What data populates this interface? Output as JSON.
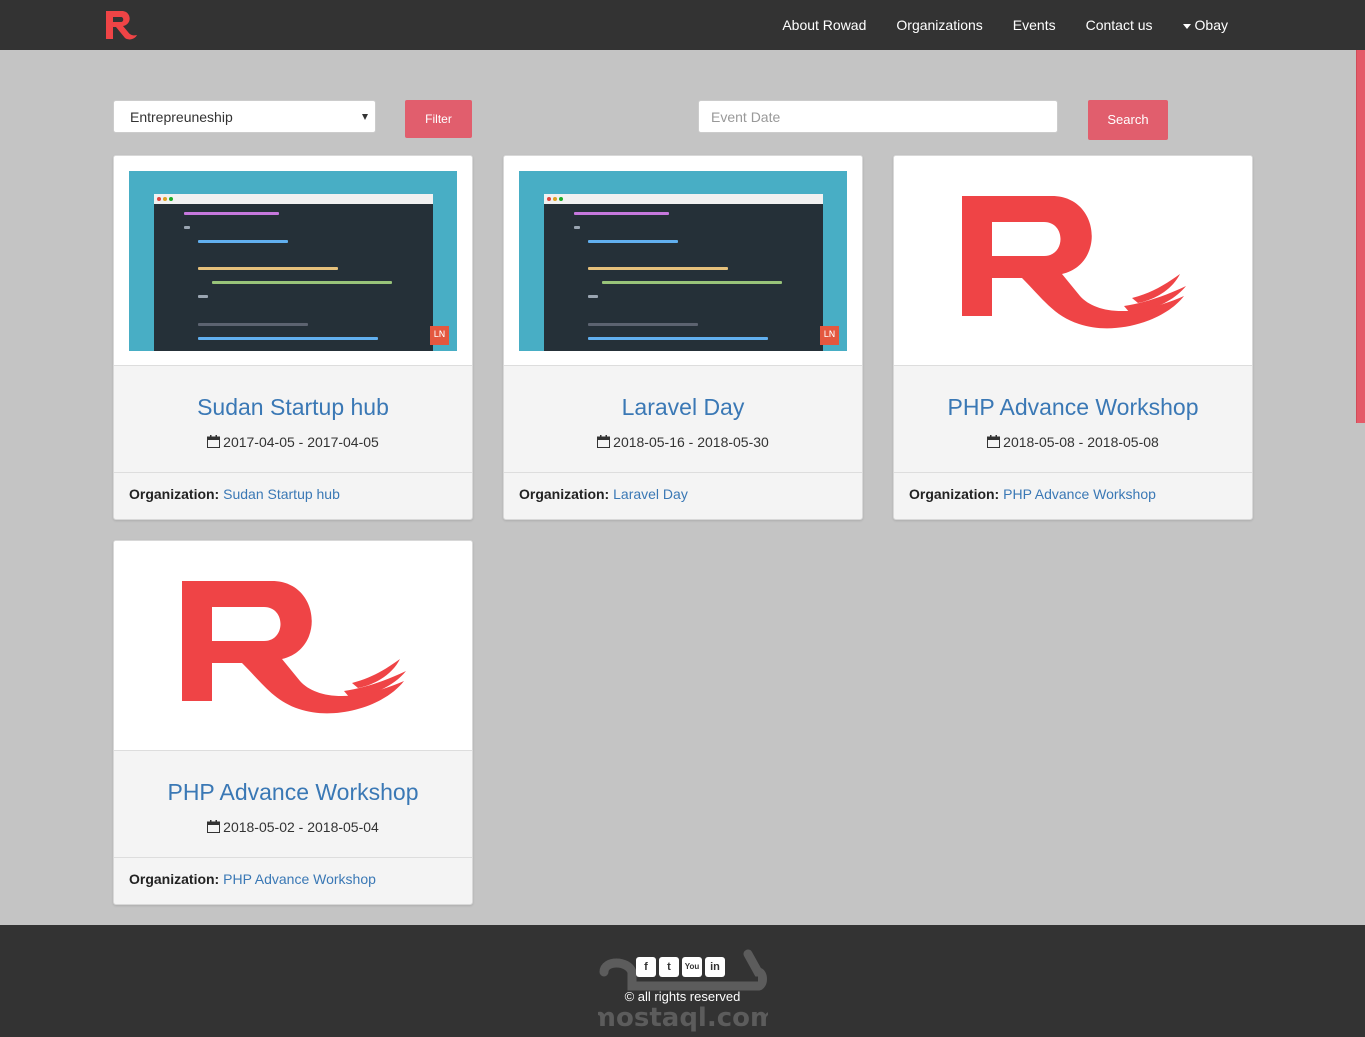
{
  "nav": {
    "items": [
      "About Rowad",
      "Organizations",
      "Events",
      "Contact us"
    ],
    "user": "Obay"
  },
  "filter": {
    "category_selected": "Entrepreuneship",
    "filter_label": "Filter",
    "date_placeholder": "Event Date",
    "search_label": "Search"
  },
  "events": [
    {
      "title": "Sudan Startup hub",
      "dates": "2017-04-05 - 2017-04-05",
      "org_label": "Organization:",
      "org": "Sudan Startup hub",
      "image": "code-screenshot",
      "badge": "LN"
    },
    {
      "title": "Laravel Day",
      "dates": "2018-05-16 - 2018-05-30",
      "org_label": "Organization:",
      "org": "Laravel Day",
      "image": "code-screenshot",
      "badge": "LN"
    },
    {
      "title": "PHP Advance Workshop",
      "dates": "2018-05-08 - 2018-05-08",
      "org_label": "Organization:",
      "org": "PHP Advance Workshop",
      "image": "rowad-logo"
    },
    {
      "title": "PHP Advance Workshop",
      "dates": "2018-05-02 - 2018-05-04",
      "org_label": "Organization:",
      "org": "PHP Advance Workshop",
      "image": "rowad-logo"
    }
  ],
  "footer": {
    "social": [
      "f",
      "t",
      "You",
      "in"
    ],
    "copyright": "© all rights reserved",
    "watermark_text": "mostaql.com"
  },
  "colors": {
    "navbar": "#333333",
    "page_bg": "#c4c4c4",
    "accent": "#e15e6d",
    "link": "#3a78b5",
    "logo_red": "#ef4446"
  }
}
